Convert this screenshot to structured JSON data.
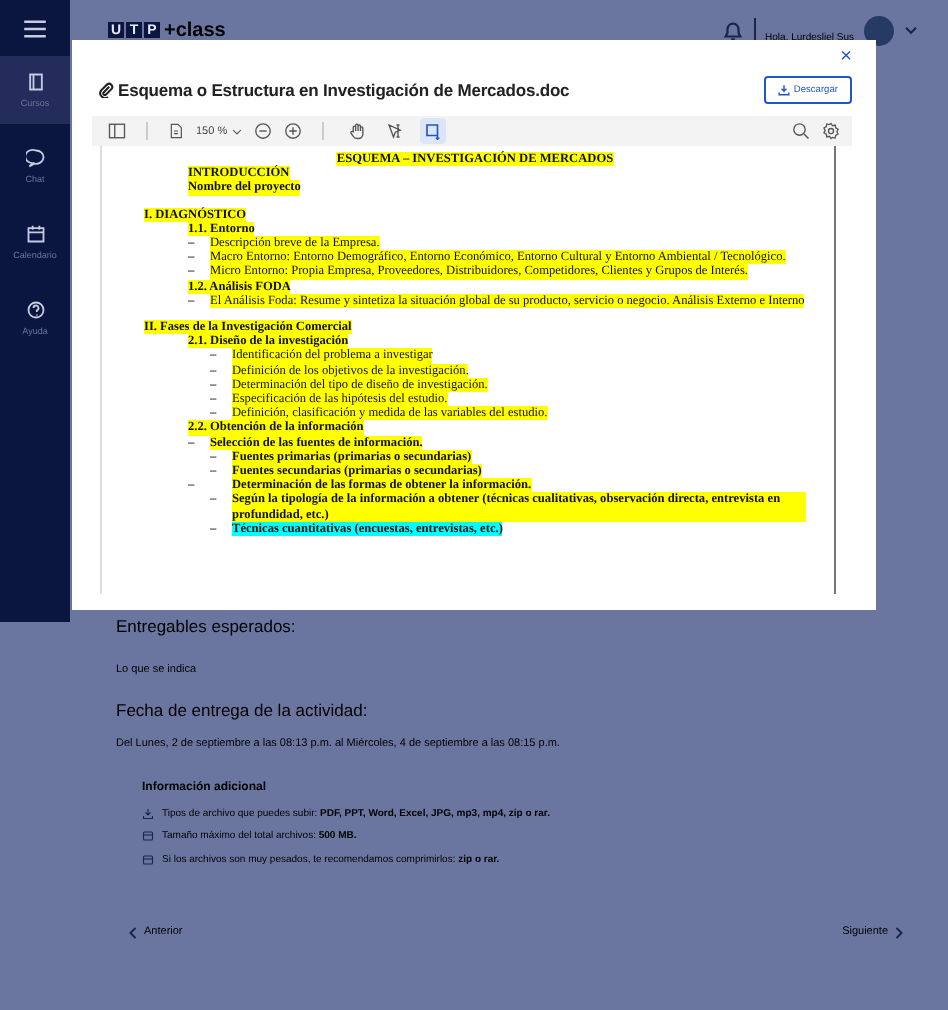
{
  "sidebar": {
    "items": [
      {
        "label": "Cursos",
        "selected": true
      },
      {
        "label": "Chat",
        "selected": false
      },
      {
        "label": "Calendario",
        "selected": false
      },
      {
        "label": "Ayuda",
        "selected": false
      }
    ]
  },
  "header": {
    "logo": {
      "letters": [
        "U",
        "T",
        "P"
      ],
      "suffix": "+class"
    },
    "greeting": "Hola, Lurdesliel Sus"
  },
  "modal": {
    "title": "Esquema o Estructura en Investigación de Mercados.doc",
    "download_button": "Descargar",
    "close": "×",
    "toolbar": {
      "zoom": "150 %",
      "tools": [
        {
          "selected": false
        },
        {
          "selected": false
        },
        {
          "selected": true
        }
      ]
    },
    "document": [
      {
        "kind": "title",
        "text": "ESQUEMA – INVESTIGACIÓN DE MERCADOS",
        "bold": true,
        "color": "#ffff00"
      },
      {
        "kind": "subheading",
        "text": "INTRODUCCIÓN",
        "bold": true,
        "color": "#ffff00"
      },
      {
        "kind": "subheading",
        "text": "Nombre del proyecto",
        "bold": true,
        "color": "#ffff00"
      },
      {
        "kind": "section",
        "text": "I. DIAGNÓSTICO",
        "bold": true,
        "color": "#ffff00",
        "children": [
          {
            "kind": "subheading",
            "text": "1.1. Entorno",
            "bold": true,
            "color": "#ffff00",
            "children": [
              {
                "kind": "item",
                "marker": "–",
                "text": "Descripción breve de la Empresa.",
                "bold": false,
                "color": "#ffff00"
              },
              {
                "kind": "item",
                "marker": "–",
                "text": "Macro Entorno: Entorno Demográfico, Entorno Económico, Entorno Cultural y Entorno Ambiental / Tecnológico.",
                "bold": false,
                "color": "#ffff00"
              },
              {
                "kind": "item",
                "marker": "–",
                "text": "Micro Entorno: Propia Empresa, Proveedores, Distribuidores, Competidores, Clientes y Grupos de Interés.",
                "bold": false,
                "color": "#ffff00"
              }
            ]
          },
          {
            "kind": "subheading",
            "text": "1.2. Análisis FODA",
            "bold": true,
            "color": "#ffff00",
            "children": [
              {
                "kind": "item",
                "marker": "–",
                "text": "El Análisis Foda: Resume y sintetiza la situación global de su producto, servicio o negocio. Análisis Externo e Interno",
                "bold": false,
                "color": "#ffff00"
              }
            ]
          }
        ]
      },
      {
        "kind": "section",
        "text": "II. Fases de la Investigación Comercial",
        "bold": true,
        "color": "#ffff00",
        "children": [
          {
            "kind": "subheading",
            "text": "2.1. Diseño de la investigación",
            "bold": true,
            "color": "#ffff00",
            "children": [
              {
                "kind": "subitem",
                "marker": "–",
                "text": "Identificación del problema a investigar",
                "bold": false,
                "color": "#ffff00"
              },
              {
                "kind": "subitem",
                "marker": "–",
                "text": "Definición de los objetivos de la investigación.",
                "bold": false,
                "color": "#ffff00"
              },
              {
                "kind": "subitem",
                "marker": "–",
                "text": "Determinación del tipo de diseño de investigación.",
                "bold": false,
                "color": "#ffff00"
              },
              {
                "kind": "subitem",
                "marker": "–",
                "text": "Especificación de las hipótesis del estudio.",
                "bold": false,
                "color": "#ffff00"
              },
              {
                "kind": "subitem",
                "marker": "–",
                "text": "Definición, clasificación y medida de las variables del estudio.",
                "bold": false,
                "color": "#ffff00"
              }
            ]
          },
          {
            "kind": "subheading",
            "text": "2.2. Obtención de la información",
            "bold": true,
            "color": "#ffff00",
            "children": [
              {
                "kind": "item",
                "marker": "–",
                "text": "Selección de las fuentes de información.",
                "bold": true,
                "color": "#ffff00",
                "children": [
                  {
                    "kind": "subitem",
                    "marker": "–",
                    "text": "Fuentes primarias (primarias o secundarias)",
                    "bold": true,
                    "color": "#ffff00"
                  },
                  {
                    "kind": "subitem",
                    "marker": "–",
                    "text": "Fuentes secundarias (primarias o secundarias)",
                    "bold": true,
                    "color": "#ffff00"
                  }
                ]
              },
              {
                "kind": "offset_item",
                "marker": "–",
                "text": "Determinación de las formas de obtener la información.",
                "bold": true,
                "color": "#ffff00",
                "children": [
                  {
                    "kind": "subitem",
                    "marker": "–",
                    "text": "Según la tipología de la información a obtener (técnicas cualitativas, observación directa, entrevista en profundidad, etc.)",
                    "bold": true,
                    "color": "#ffff00"
                  },
                  {
                    "kind": "subitem",
                    "marker": "–",
                    "text": "Técnicas cuantitativas (encuestas, entrevistas, etc.)",
                    "bold": true,
                    "color": "#00ffff"
                  }
                ]
              }
            ]
          }
        ]
      }
    ]
  },
  "content": {
    "deliverables_heading": "Entregables esperados:",
    "deliverables_text": "Lo que se indica",
    "due_heading": "Fecha de entrega de la actividad:",
    "due_text": "Del Lunes, 2 de septiembre a las 08:13 p.m. al Miércoles, 4 de septiembre a las 08:15 p.m.",
    "info": {
      "title": "Información adicional",
      "lines": [
        {
          "text": "Tipos de archivo que puedes subir: **PDF, PPT, Word, Excel, JPG, mp3, mp4, zip o rar.**"
        },
        {
          "text": "Tamaño máximo del total archivos: **500 MB.**"
        },
        {
          "text": "Si los archivos son muy pesados, te recomendamos comprimirlos: **zip o rar.**"
        }
      ]
    },
    "previous": "Anterior",
    "next": "Siguiente"
  }
}
